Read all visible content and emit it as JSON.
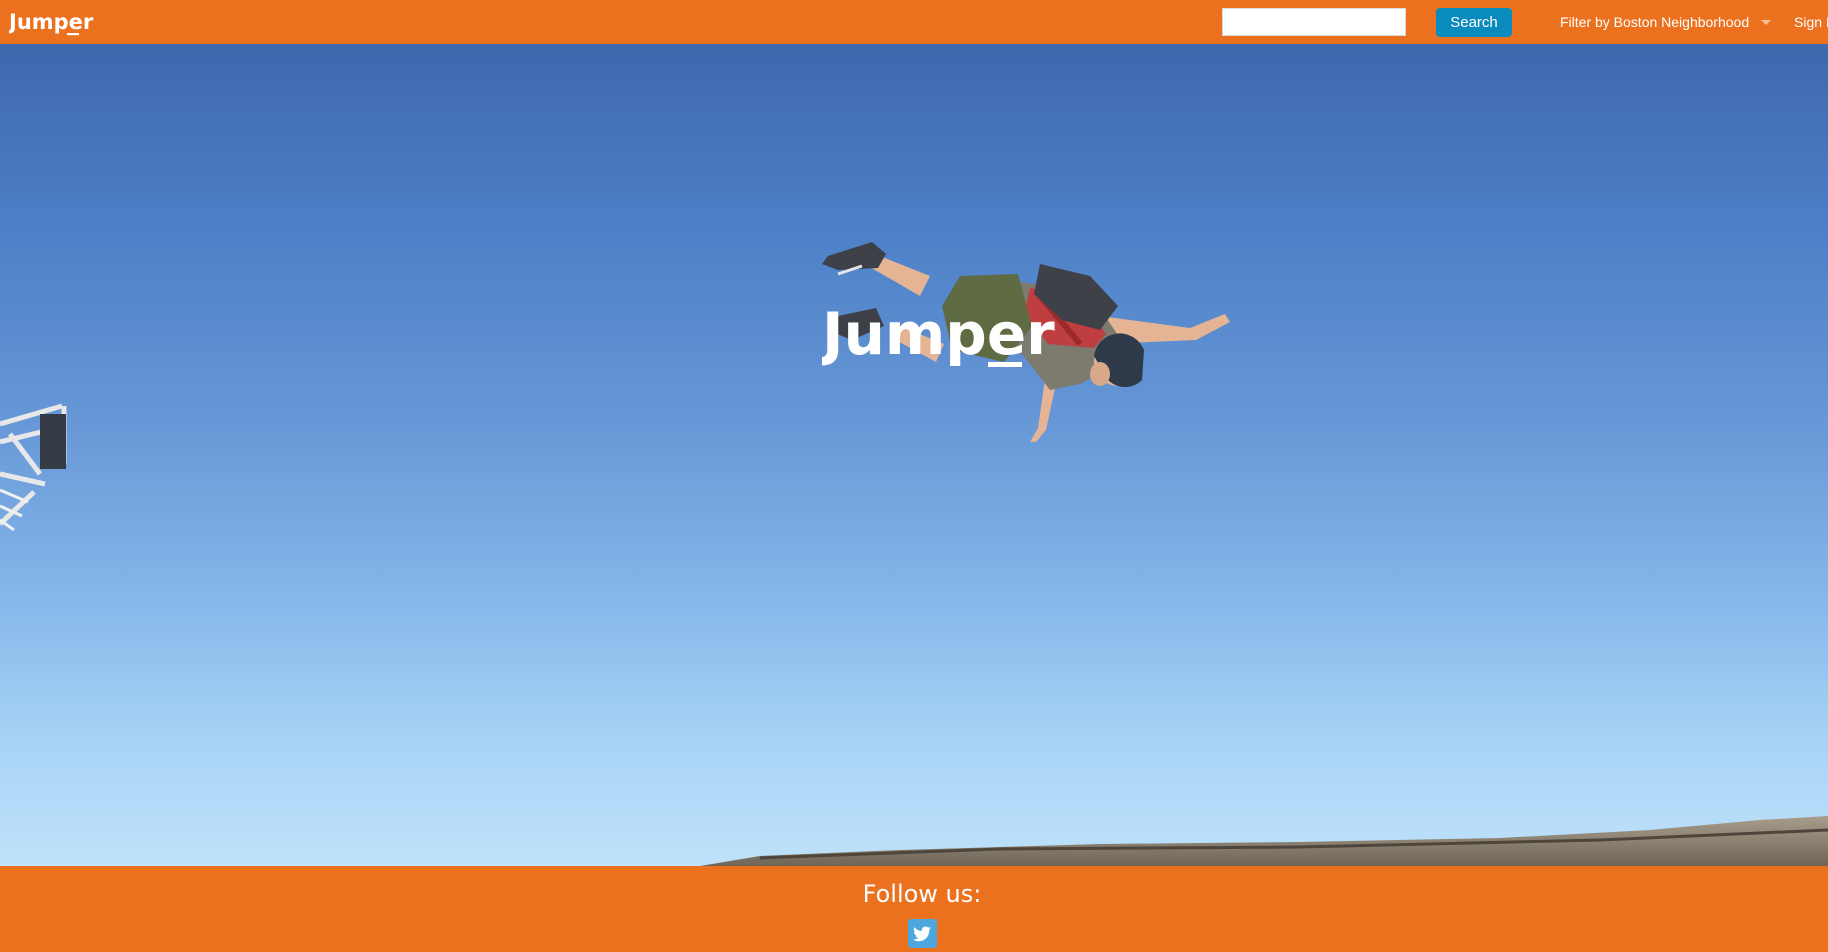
{
  "header": {
    "brand": "Jumper",
    "search": {
      "value": "",
      "placeholder": "",
      "button_label": "Search"
    },
    "filter_label": "Filter by Boston Neighborhood",
    "signin_label": "Sign In",
    "background_color": "#ec711e"
  },
  "hero": {
    "logo_text": "Jumper",
    "image_subject": "BASE jumper flipping upside down against a clear blue sky"
  },
  "footer": {
    "follow_text": "Follow us:",
    "social_icon": "twitter-icon",
    "background_color": "#ec711e"
  },
  "colors": {
    "accent": "#ec711e",
    "button": "#0a8bbd",
    "twitter": "#4da7de"
  }
}
